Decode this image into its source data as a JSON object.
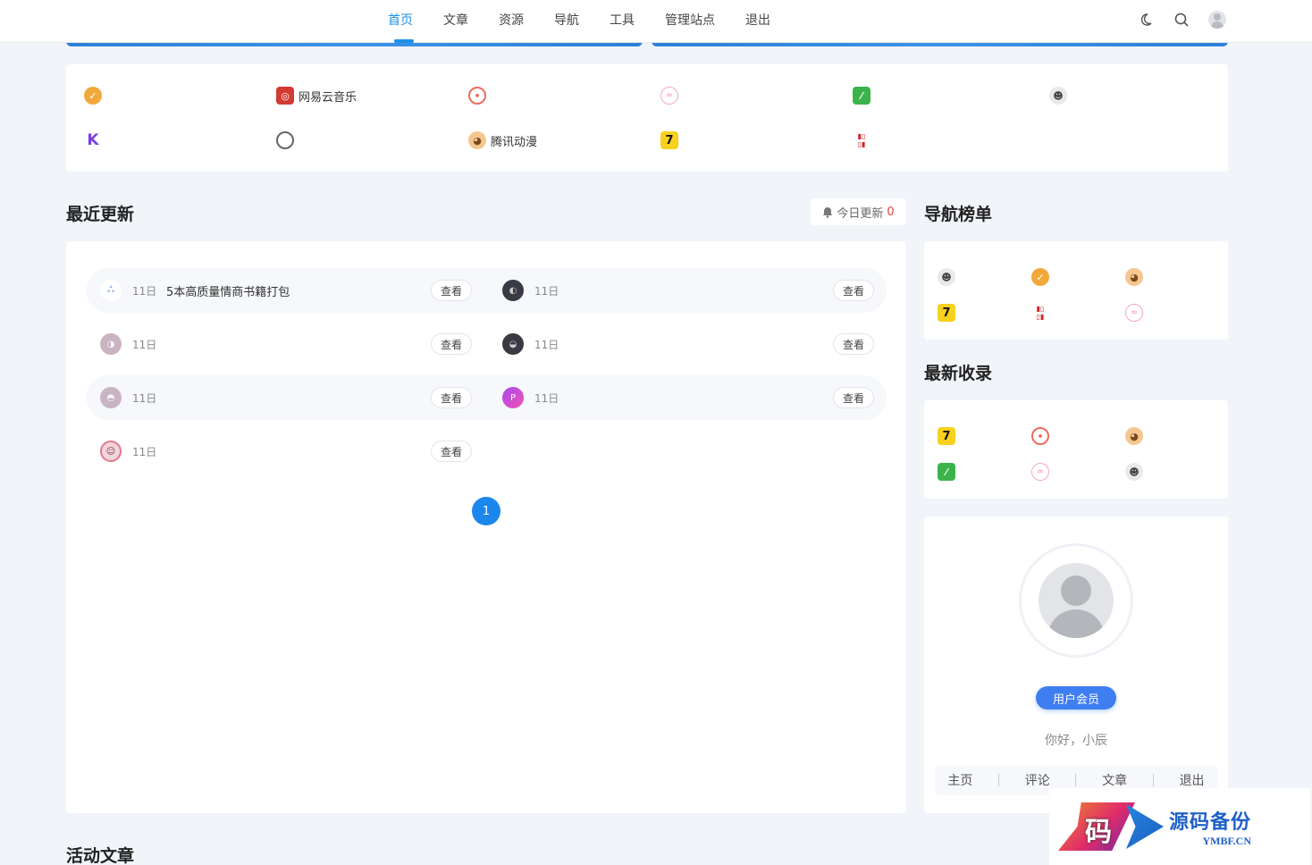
{
  "nav": {
    "items": [
      {
        "label": "首页",
        "active": true
      },
      {
        "label": "文章"
      },
      {
        "label": "资源"
      },
      {
        "label": "导航"
      },
      {
        "label": "工具"
      },
      {
        "label": "管理站点"
      },
      {
        "label": "退出"
      }
    ],
    "icons": [
      "moon-icon",
      "search-icon",
      "user-avatar"
    ]
  },
  "links": [
    {
      "icon": "verified-badge-icon",
      "label": ""
    },
    {
      "icon": "netease-music-icon",
      "label": "网易云音乐"
    },
    {
      "icon": "target-icon",
      "label": ""
    },
    {
      "icon": "pig-icon",
      "label": ""
    },
    {
      "icon": "green-leaf-icon",
      "label": ""
    },
    {
      "icon": "ninja-icon",
      "label": ""
    },
    {
      "icon": "k-logo-icon",
      "label": ""
    },
    {
      "icon": "q-logo-icon",
      "label": ""
    },
    {
      "icon": "monkey-icon",
      "label": "腾讯动漫"
    },
    {
      "icon": "seven-cat-icon",
      "label": ""
    },
    {
      "icon": "xiaodao-icon",
      "label": ""
    }
  ],
  "recent": {
    "title": "最近更新",
    "today_label": "今日更新",
    "today_count": "0",
    "view_label": "查看",
    "items": [
      {
        "date": "11日",
        "title": "5本高质量情商书籍打包"
      },
      {
        "date": "11日",
        "title": ""
      },
      {
        "date": "11日",
        "title": ""
      },
      {
        "date": "11日",
        "title": ""
      },
      {
        "date": "11日",
        "title": ""
      },
      {
        "date": "11日",
        "title": ""
      },
      {
        "date": "11日",
        "title": ""
      }
    ],
    "page": "1"
  },
  "ranking": {
    "title": "导航榜单"
  },
  "latest": {
    "title": "最新收录"
  },
  "profile": {
    "member_label": "用户会员",
    "greeting": "你好，小辰",
    "links": [
      "主页",
      "评论",
      "文章",
      "退出"
    ]
  },
  "articles": {
    "title": "活动文章"
  },
  "watermark": {
    "cn": "源码备份",
    "en": "YMBF.CN",
    "glyph": "码"
  }
}
